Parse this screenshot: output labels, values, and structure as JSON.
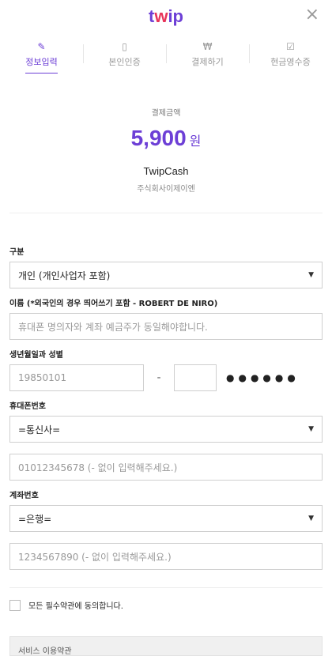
{
  "header": {
    "logo_prefix": "t",
    "logo_heart": "w",
    "logo_suffix": "ip",
    "close_glyph": "×"
  },
  "steps": [
    {
      "label": "정보입력",
      "icon": "✎",
      "active": true
    },
    {
      "label": "본인인증",
      "icon": "▯",
      "active": false
    },
    {
      "label": "결제하기",
      "icon": "₩",
      "active": false
    },
    {
      "label": "현금영수증",
      "icon": "☑",
      "active": false
    }
  ],
  "payment": {
    "caption": "결제금액",
    "amount": "5,900",
    "currency": "원",
    "service": "TwipCash",
    "company": "주식회사이제이엔"
  },
  "form": {
    "type": {
      "label": "구분",
      "value": "개인 (개인사업자 포함)",
      "arrow": "▼"
    },
    "name": {
      "label": "이름 (*외국인의 경우 띄어쓰기 포함 - ROBERT DE NIRO)",
      "placeholder": "휴대폰 명의자와 계좌 예금주가 동일해야합니다."
    },
    "birth": {
      "label": "생년월일과 성별",
      "placeholder": "19850101",
      "dash": "-",
      "dots": "●●●●●●"
    },
    "phone": {
      "label": "휴대폰번호",
      "carrier": "=통신사=",
      "arrow": "▼",
      "placeholder": "01012345678 (- 없이 입력해주세요.)"
    },
    "account": {
      "label": "계좌번호",
      "bank": "=은행=",
      "arrow": "▼",
      "placeholder": "1234567890 (- 없이 입력해주세요.)"
    }
  },
  "agree": {
    "label": "모든 필수약관에 동의합니다."
  },
  "terms": {
    "label": "서비스 이용약관"
  }
}
